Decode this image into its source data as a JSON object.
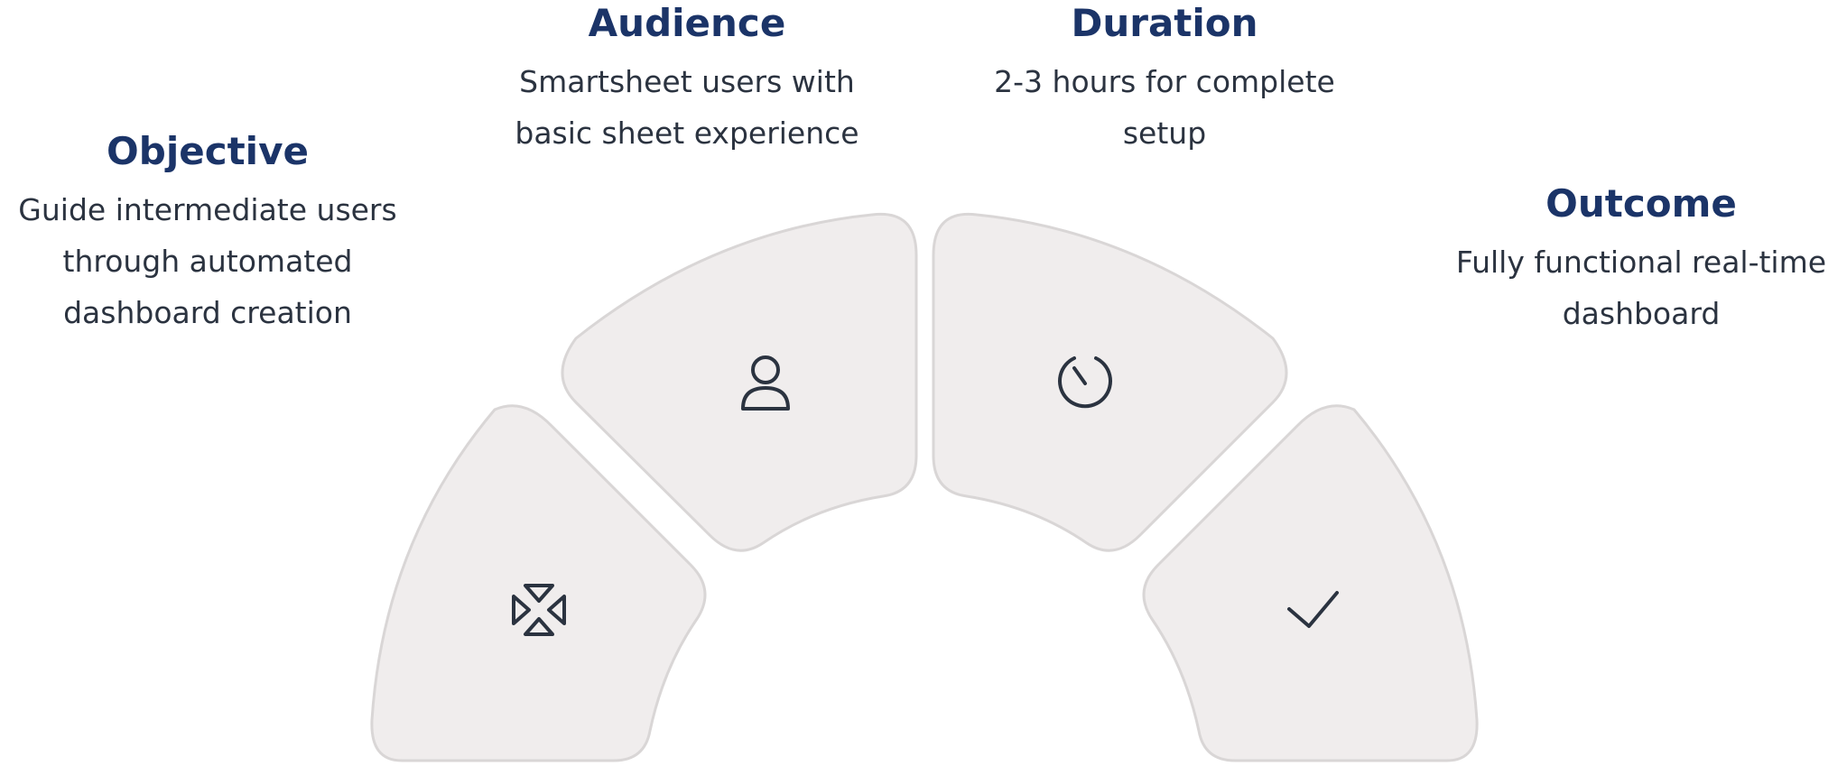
{
  "segments": [
    {
      "id": "objective",
      "title": "Objective",
      "lines": [
        "Guide intermediate users",
        "through automated",
        "dashboard creation"
      ],
      "icon": "minimize-arrows-icon"
    },
    {
      "id": "audience",
      "title": "Audience",
      "lines": [
        "Smartsheet users with",
        "basic sheet experience"
      ],
      "icon": "user-icon"
    },
    {
      "id": "duration",
      "title": "Duration",
      "lines": [
        "2-3 hours for complete",
        "setup"
      ],
      "icon": "timer-icon"
    },
    {
      "id": "outcome",
      "title": "Outcome",
      "lines": [
        "Fully functional real-time",
        "dashboard"
      ],
      "icon": "checkmark-icon"
    }
  ],
  "colors": {
    "title": "#1b3468",
    "text": "#2b3340",
    "segment_fill": "#f0eded",
    "segment_stroke": "#d9d6d6"
  }
}
